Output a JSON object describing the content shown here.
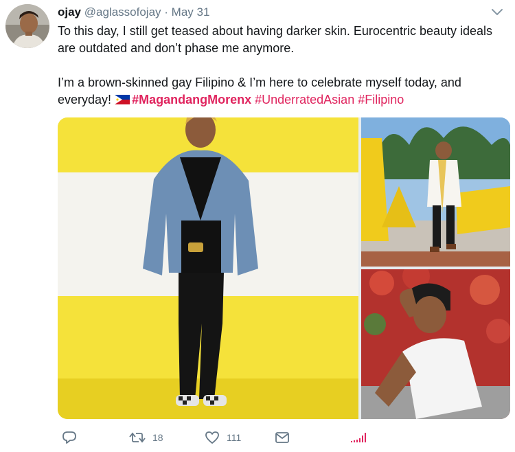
{
  "tweet": {
    "author": {
      "name": "ojay",
      "handle": "@aglassofojay",
      "separator": "·",
      "date": "May 31"
    },
    "text": {
      "paragraph1": "To this day, I still get teased about having darker skin. Eurocentric beauty ideals are outdated and don’t phase me anymore.",
      "paragraph2_prefix": "I’m a brown-skinned gay Filipino & I’m here to celebrate myself today, and everyday!",
      "hashtags": [
        {
          "text": "#MagandangMorenx",
          "bold": true
        },
        {
          "text": "#UnderratedAsian",
          "bold": false
        },
        {
          "text": "#Filipino",
          "bold": false
        }
      ],
      "flag_emoji": "philippines-flag-icon"
    },
    "media": {
      "photos": [
        {
          "description": "man in denim jacket in front of yellow wall"
        },
        {
          "description": "graduate in front of yellow letters"
        },
        {
          "description": "man in beanie and white t-shirt"
        }
      ]
    },
    "actions": {
      "reply": {
        "icon": "reply-icon"
      },
      "retweet": {
        "icon": "retweet-icon",
        "count": "18"
      },
      "like": {
        "icon": "heart-icon",
        "count": "111"
      },
      "message": {
        "icon": "envelope-icon"
      },
      "analytics": {
        "icon": "analytics-icon"
      }
    },
    "colors": {
      "hashtag": "#e0245e",
      "secondary": "#657786",
      "text": "#14171a"
    }
  }
}
